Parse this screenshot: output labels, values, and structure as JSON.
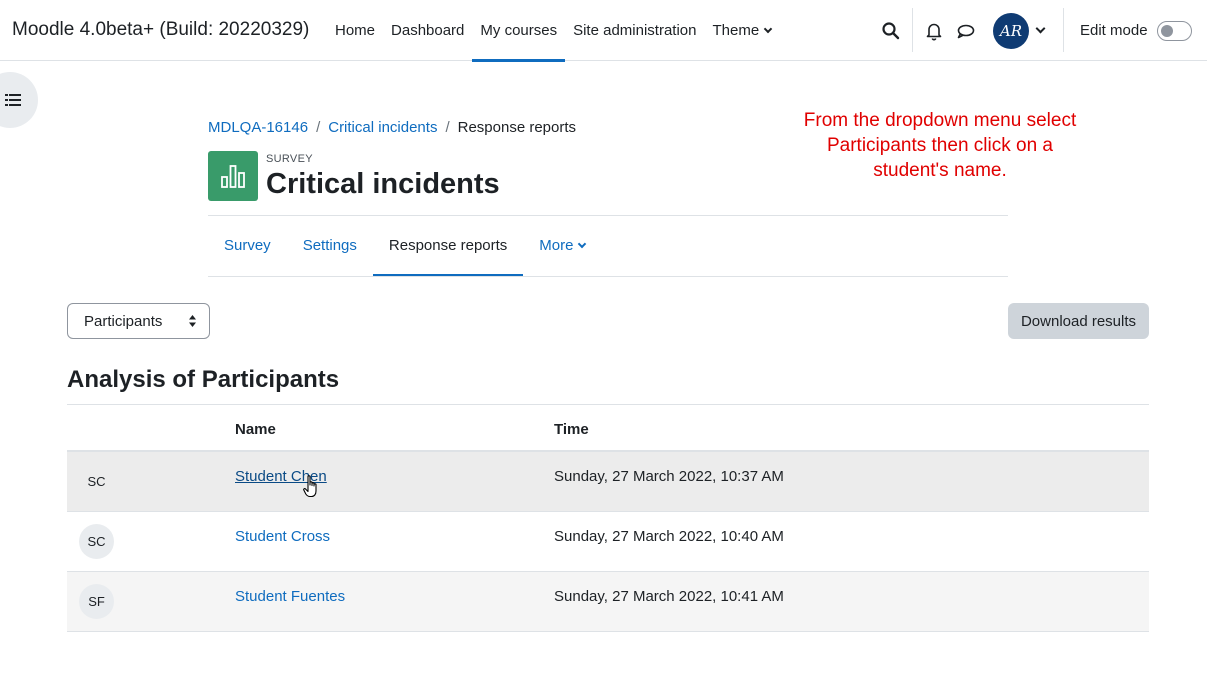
{
  "header": {
    "site_name": "Moodle 4.0beta+ (Build: 20220329)",
    "nav": [
      {
        "label": "Home"
      },
      {
        "label": "Dashboard"
      },
      {
        "label": "My courses"
      },
      {
        "label": "Site administration"
      },
      {
        "label": "Theme"
      }
    ],
    "active_nav": "My courses",
    "user_initials": "AR",
    "edit_mode_label": "Edit mode",
    "edit_mode_on": false,
    "icons": [
      "search-icon",
      "bell-icon",
      "chat-icon",
      "chevron-down-icon"
    ]
  },
  "breadcrumb": {
    "items": [
      "MDLQA-16146",
      "Critical incidents",
      "Response reports"
    ],
    "separator": "/"
  },
  "annotation": {
    "text": "From the dropdown menu select Participants then click on a student's name."
  },
  "activity": {
    "type": "SURVEY",
    "title": "Critical incidents",
    "icon_color": "#399b6a"
  },
  "secondary_nav": {
    "tabs": [
      {
        "label": "Survey"
      },
      {
        "label": "Settings"
      },
      {
        "label": "Response reports"
      },
      {
        "label": "More"
      }
    ],
    "active": "Response reports"
  },
  "controls": {
    "report_select_value": "Participants",
    "download_label": "Download results"
  },
  "analysis": {
    "heading": "Analysis of Participants",
    "columns": [
      "Name",
      "Time"
    ],
    "rows": [
      {
        "initials": "SC",
        "name": "Student Chen",
        "time": "Sunday, 27 March 2022, 10:37 AM"
      },
      {
        "initials": "SC",
        "name": "Student Cross",
        "time": "Sunday, 27 March 2022, 10:40 AM"
      },
      {
        "initials": "SF",
        "name": "Student Fuentes",
        "time": "Sunday, 27 March 2022, 10:41 AM"
      }
    ]
  },
  "colors": {
    "accent": "#0f6cbf",
    "annotation": "#e00000"
  }
}
